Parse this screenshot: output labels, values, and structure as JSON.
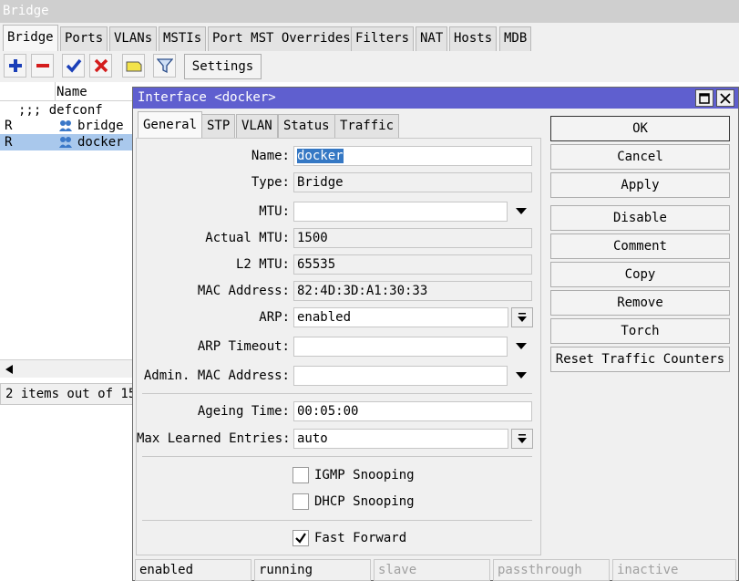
{
  "window": {
    "title": "Bridge"
  },
  "main_tabs": [
    {
      "label": "Bridge",
      "active": true
    },
    {
      "label": "Ports"
    },
    {
      "label": "VLANs"
    },
    {
      "label": "MSTIs"
    },
    {
      "label": "Port MST Overrides"
    },
    {
      "label": "Filters"
    },
    {
      "label": "NAT"
    },
    {
      "label": "Hosts"
    },
    {
      "label": "MDB"
    }
  ],
  "toolbar": {
    "add_icon": "plus-icon",
    "remove_icon": "minus-icon",
    "enable_icon": "check-icon",
    "disable_icon": "x-icon",
    "comment_icon": "note-icon",
    "filter_icon": "filter-icon",
    "settings_label": "Settings"
  },
  "list": {
    "column_name": "Name",
    "comment_row": ";;; defconf",
    "rows": [
      {
        "flag": "R",
        "name": "bridge",
        "selected": false
      },
      {
        "flag": "R",
        "name": "docker",
        "selected": true
      }
    ],
    "status": "2 items out of 15"
  },
  "dialog": {
    "title": "Interface <docker>",
    "tabs": [
      {
        "label": "General",
        "active": true
      },
      {
        "label": "STP"
      },
      {
        "label": "VLAN"
      },
      {
        "label": "Status"
      },
      {
        "label": "Traffic"
      }
    ],
    "fields": {
      "name_label": "Name:",
      "name_value": "docker",
      "type_label": "Type:",
      "type_value": "Bridge",
      "mtu_label": "MTU:",
      "mtu_value": "",
      "actual_mtu_label": "Actual MTU:",
      "actual_mtu_value": "1500",
      "l2_mtu_label": "L2 MTU:",
      "l2_mtu_value": "65535",
      "mac_label": "MAC Address:",
      "mac_value": "82:4D:3D:A1:30:33",
      "arp_label": "ARP:",
      "arp_value": "enabled",
      "arp_timeout_label": "ARP Timeout:",
      "arp_timeout_value": "",
      "admin_mac_label": "Admin. MAC Address:",
      "admin_mac_value": "",
      "ageing_label": "Ageing Time:",
      "ageing_value": "00:05:00",
      "max_learned_label": "Max Learned Entries:",
      "max_learned_value": "auto"
    },
    "checkboxes": {
      "igmp_label": "IGMP Snooping",
      "igmp_checked": false,
      "dhcp_label": "DHCP Snooping",
      "dhcp_checked": false,
      "fast_forward_label": "Fast Forward",
      "fast_forward_checked": true
    },
    "buttons": {
      "ok": "OK",
      "cancel": "Cancel",
      "apply": "Apply",
      "disable": "Disable",
      "comment": "Comment",
      "copy": "Copy",
      "remove": "Remove",
      "torch": "Torch",
      "reset_traffic": "Reset Traffic Counters"
    },
    "status_bar": [
      "enabled",
      "running",
      "slave",
      "passthrough",
      "inactive"
    ]
  }
}
